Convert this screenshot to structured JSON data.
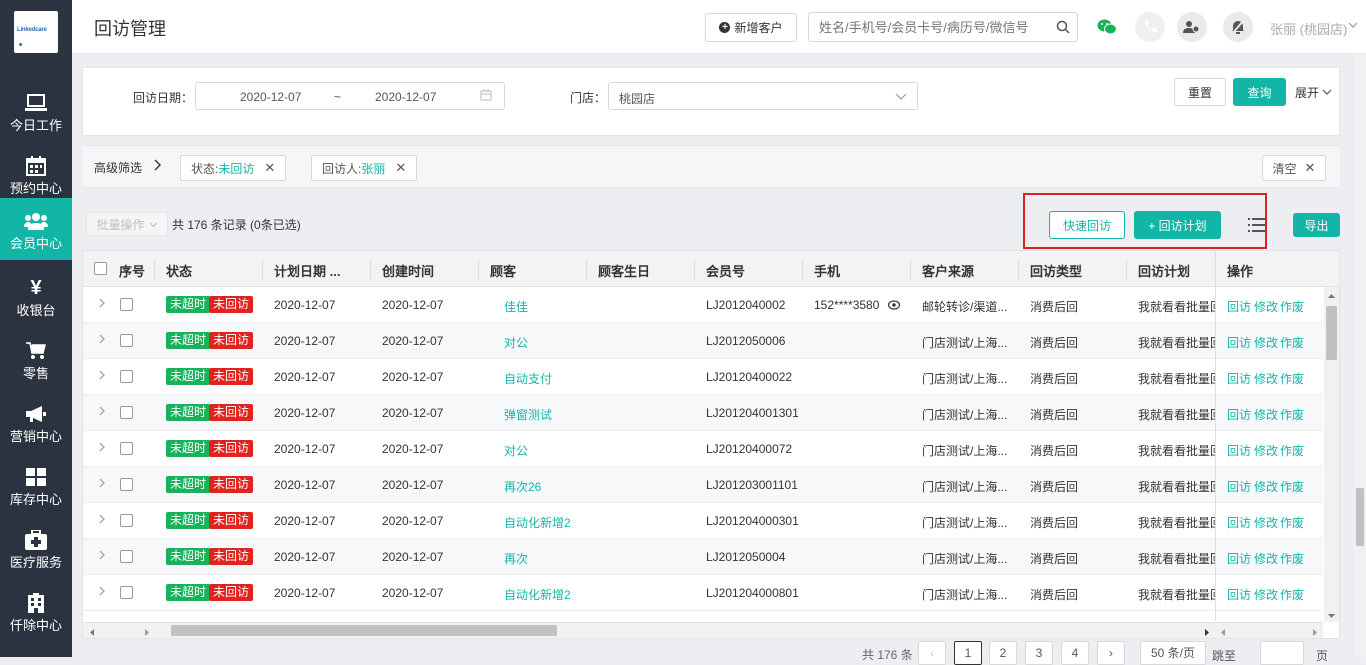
{
  "sidebar": {
    "logo_text": "Linkedcare",
    "items": [
      {
        "label": "今日工作",
        "icon": "laptop-icon",
        "active": false
      },
      {
        "label": "预约中心",
        "icon": "calendar-icon",
        "active": false
      },
      {
        "label": "会员中心",
        "icon": "users-icon",
        "active": true
      },
      {
        "label": "收银台",
        "icon": "yen-icon",
        "active": false
      },
      {
        "label": "零售",
        "icon": "cart-icon",
        "active": false
      },
      {
        "label": "营销中心",
        "icon": "megaphone-icon",
        "active": false
      },
      {
        "label": "库存中心",
        "icon": "grid-icon",
        "active": false
      },
      {
        "label": "医疗服务",
        "icon": "medkit-icon",
        "active": false
      },
      {
        "label": "仟除中心",
        "icon": "building-icon",
        "active": false
      }
    ]
  },
  "header": {
    "title": "回访管理",
    "add_customer_label": "新增客户",
    "search_placeholder": "姓名/手机号/会员卡号/病历号/微信号",
    "user_name": "张丽 (桃园店)",
    "accent_color": "#13b5a6"
  },
  "filter": {
    "date_label": "回访日期：",
    "date_start": "2020-12-07",
    "date_sep": "~",
    "date_end": "2020-12-07",
    "store_label": "门店：",
    "store_value": "桃园店",
    "reset_label": "重置",
    "query_label": "查询",
    "expand_label": "展开"
  },
  "advanced": {
    "label": "高级筛选",
    "tags": [
      {
        "key": "状态: ",
        "value": "未回访"
      },
      {
        "key": "回访人: ",
        "value": "张丽"
      }
    ],
    "clear_label": "清空"
  },
  "toolbar": {
    "batch_label": "批量操作",
    "record_count": "共 176 条记录  (0条已选)",
    "quick_label": "快速回访",
    "plan_label": "+ 回访计划",
    "export_label": "导出"
  },
  "table": {
    "columns": [
      "序号",
      "状态",
      "计划日期 ...",
      "创建时间",
      "顾客",
      "顾客生日",
      "会员号",
      "手机",
      "客户来源",
      "回访类型",
      "回访计划",
      "操作"
    ],
    "status_badges": [
      "未超时",
      "未回访"
    ],
    "actions": [
      "回访",
      "修改",
      "作废"
    ],
    "rows": [
      {
        "plan_date": "2020-12-07",
        "created": "2020-12-07",
        "customer": "佳佳",
        "birthday": "",
        "member_no": "LJ2012040002",
        "phone": "152****3580",
        "source": "邮轮转诊/渠道...",
        "type": "消费后回",
        "plan": "我就看看批量回"
      },
      {
        "plan_date": "2020-12-07",
        "created": "2020-12-07",
        "customer": "对公",
        "birthday": "",
        "member_no": "LJ2012050006",
        "phone": "",
        "source": "门店测试/上海...",
        "type": "消费后回",
        "plan": "我就看看批量回"
      },
      {
        "plan_date": "2020-12-07",
        "created": "2020-12-07",
        "customer": "自动支付",
        "birthday": "",
        "member_no": "LJ2012040002‌2",
        "phone": "",
        "source": "门店测试/上海...",
        "type": "消费后回",
        "plan": "我就看看批量回"
      },
      {
        "plan_date": "2020-12-07",
        "created": "2020-12-07",
        "customer": "弹窗测试",
        "birthday": "",
        "member_no": "LJ201204001301",
        "phone": "",
        "source": "门店测试/上海...",
        "type": "消费后回",
        "plan": "我就看看批量回"
      },
      {
        "plan_date": "2020-12-07",
        "created": "2020-12-07",
        "customer": "对公",
        "birthday": "",
        "member_no": "LJ2012040007‌2",
        "phone": "",
        "source": "门店测试/上海...",
        "type": "消费后回",
        "plan": "我就看看批量回"
      },
      {
        "plan_date": "2020-12-07",
        "created": "2020-12-07",
        "customer": "再次26",
        "birthday": "",
        "member_no": "LJ201203001101",
        "phone": "",
        "source": "门店测试/上海...",
        "type": "消费后回",
        "plan": "我就看看批量回"
      },
      {
        "plan_date": "2020-12-07",
        "created": "2020-12-07",
        "customer": "自动化新增2",
        "birthday": "",
        "member_no": "LJ201204000301",
        "phone": "",
        "source": "门店测试/上海...",
        "type": "消费后回",
        "plan": "我就看看批量回"
      },
      {
        "plan_date": "2020-12-07",
        "created": "2020-12-07",
        "customer": "再次",
        "birthday": "",
        "member_no": "LJ2012050004",
        "phone": "",
        "source": "门店测试/上海...",
        "type": "消费后回",
        "plan": "我就看看批量回"
      },
      {
        "plan_date": "2020-12-07",
        "created": "2020-12-07",
        "customer": "自动化新增2",
        "birthday": "",
        "member_no": "LJ201204000801",
        "phone": "",
        "source": "门店测试/上海...",
        "type": "消费后回",
        "plan": "我就看看批量回"
      }
    ]
  },
  "pager": {
    "total": "共 176 条",
    "pages": [
      "1",
      "2",
      "3",
      "4"
    ],
    "current": "1",
    "page_size": "50 条/页",
    "jump_label": "跳至",
    "page_label": "页"
  }
}
